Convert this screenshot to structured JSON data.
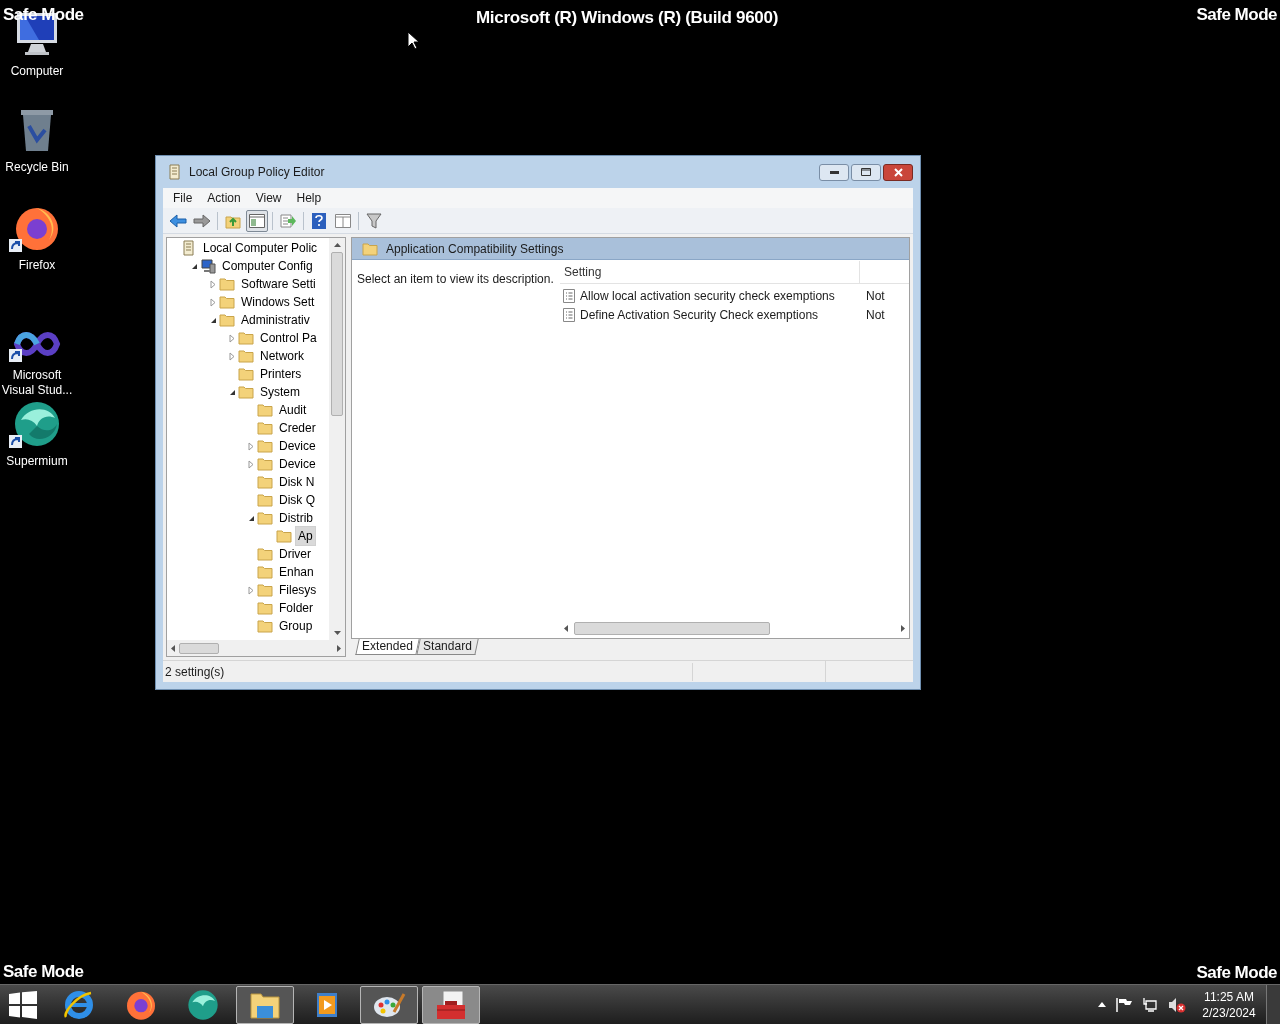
{
  "overlay": {
    "title": "Microsoft (R) Windows (R) (Build 9600)",
    "top_left": "Safe Mode",
    "top_right": "Safe Mode",
    "bottom_left": "Safe Mode",
    "bottom_right": "Safe Mode"
  },
  "desktop_icons": [
    {
      "kind": "computer",
      "label": "Computer",
      "shortcut": false
    },
    {
      "kind": "recycle-bin",
      "label": "Recycle Bin",
      "shortcut": false
    },
    {
      "kind": "firefox",
      "label": "Firefox",
      "shortcut": true
    },
    {
      "kind": "visual-studio",
      "label": "Microsoft Visual Stud...",
      "shortcut": true
    },
    {
      "kind": "supermium",
      "label": "Supermium",
      "shortcut": true
    }
  ],
  "window": {
    "title": "Local Group Policy Editor",
    "menu": [
      "File",
      "Action",
      "View",
      "Help"
    ],
    "toolbar": [
      {
        "kind": "back",
        "pressed": false
      },
      {
        "kind": "forward",
        "pressed": false
      },
      {
        "kind": "up",
        "pressed": false
      },
      {
        "kind": "tree",
        "pressed": true
      },
      {
        "kind": "export",
        "pressed": false
      },
      {
        "kind": "help",
        "pressed": false
      },
      {
        "kind": "view",
        "pressed": false
      },
      {
        "kind": "filter",
        "pressed": false
      }
    ],
    "tree": [
      {
        "kind": "policy",
        "label": "Local Computer Polic",
        "selected": false,
        "children": [
          {
            "kind": "computer",
            "label": "Computer Config",
            "expanded": true,
            "selected": false,
            "children": [
              {
                "kind": "folder",
                "label": "Software Setti",
                "expanded": false,
                "selected": false
              },
              {
                "kind": "folder",
                "label": "Windows Sett",
                "expanded": false,
                "selected": false
              },
              {
                "kind": "folder",
                "label": "Administrativ",
                "expanded": true,
                "selected": false,
                "children": [
                  {
                    "kind": "folder",
                    "label": "Control Pa",
                    "expanded": false,
                    "selected": false
                  },
                  {
                    "kind": "folder",
                    "label": "Network",
                    "expanded": false,
                    "selected": false
                  },
                  {
                    "kind": "folder",
                    "label": "Printers",
                    "selected": false
                  },
                  {
                    "kind": "folder",
                    "label": "System",
                    "expanded": true,
                    "selected": false,
                    "children": [
                      {
                        "kind": "folder",
                        "label": "Audit",
                        "selected": false
                      },
                      {
                        "kind": "folder",
                        "label": "Creder",
                        "selected": false
                      },
                      {
                        "kind": "folder",
                        "label": "Device",
                        "expanded": false,
                        "selected": false
                      },
                      {
                        "kind": "folder",
                        "label": "Device",
                        "expanded": false,
                        "selected": false
                      },
                      {
                        "kind": "folder",
                        "label": "Disk N",
                        "selected": false
                      },
                      {
                        "kind": "folder",
                        "label": "Disk Q",
                        "selected": false
                      },
                      {
                        "kind": "folder",
                        "label": "Distrib",
                        "expanded": true,
                        "selected": false,
                        "children": [
                          {
                            "kind": "folder",
                            "label": "Ap",
                            "selected": true
                          }
                        ]
                      },
                      {
                        "kind": "folder",
                        "label": "Driver",
                        "selected": false
                      },
                      {
                        "kind": "folder",
                        "label": "Enhan",
                        "selected": false
                      },
                      {
                        "kind": "folder",
                        "label": "Filesys",
                        "expanded": false,
                        "selected": false
                      },
                      {
                        "kind": "folder",
                        "label": "Folder",
                        "selected": false
                      },
                      {
                        "kind": "folder",
                        "label": "Group",
                        "selected": false
                      }
                    ]
                  }
                ]
              }
            ]
          }
        ]
      }
    ],
    "details": {
      "header": "Application Compatibility Settings",
      "description": "Select an item to view its description.",
      "columns": [
        "Setting"
      ],
      "rows": [
        {
          "setting": "Allow local activation security check exemptions",
          "column_2": "Not"
        },
        {
          "setting": "Define Activation Security Check exemptions",
          "column_2": "Not"
        }
      ],
      "tabs": [
        {
          "label": "Extended",
          "selected": true
        },
        {
          "label": "Standard",
          "selected": false
        }
      ]
    },
    "status_bar": "2 setting(s)"
  },
  "taskbar": {
    "items": [
      {
        "kind": "start",
        "running": false,
        "active": false
      },
      {
        "kind": "internet-explorer",
        "running": false,
        "active": false
      },
      {
        "kind": "firefox",
        "running": false,
        "active": false
      },
      {
        "kind": "supermium",
        "running": false,
        "active": false
      },
      {
        "kind": "explorer",
        "running": true,
        "active": false
      },
      {
        "kind": "media-player",
        "running": false,
        "active": false
      },
      {
        "kind": "paint",
        "running": true,
        "active": false
      },
      {
        "kind": "toolbox",
        "running": true,
        "active": true
      }
    ],
    "tray": [
      {
        "kind": "up"
      },
      {
        "kind": "flag"
      },
      {
        "kind": "network"
      },
      {
        "kind": "volume-muted"
      }
    ],
    "time": "11:25 AM",
    "date": "2/23/2024"
  }
}
